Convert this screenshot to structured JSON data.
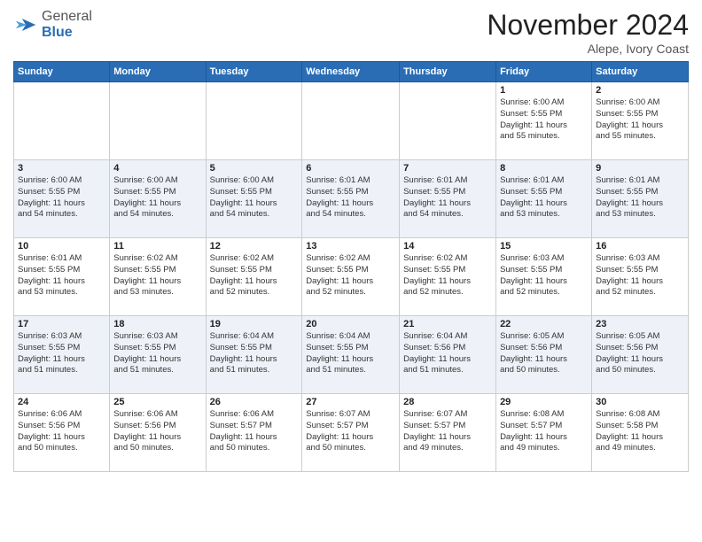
{
  "logo": {
    "general": "General",
    "blue": "Blue"
  },
  "header": {
    "month": "November 2024",
    "location": "Alepe, Ivory Coast"
  },
  "weekdays": [
    "Sunday",
    "Monday",
    "Tuesday",
    "Wednesday",
    "Thursday",
    "Friday",
    "Saturday"
  ],
  "weeks": [
    [
      {
        "day": "",
        "info": ""
      },
      {
        "day": "",
        "info": ""
      },
      {
        "day": "",
        "info": ""
      },
      {
        "day": "",
        "info": ""
      },
      {
        "day": "",
        "info": ""
      },
      {
        "day": "1",
        "info": "Sunrise: 6:00 AM\nSunset: 5:55 PM\nDaylight: 11 hours\nand 55 minutes."
      },
      {
        "day": "2",
        "info": "Sunrise: 6:00 AM\nSunset: 5:55 PM\nDaylight: 11 hours\nand 55 minutes."
      }
    ],
    [
      {
        "day": "3",
        "info": "Sunrise: 6:00 AM\nSunset: 5:55 PM\nDaylight: 11 hours\nand 54 minutes."
      },
      {
        "day": "4",
        "info": "Sunrise: 6:00 AM\nSunset: 5:55 PM\nDaylight: 11 hours\nand 54 minutes."
      },
      {
        "day": "5",
        "info": "Sunrise: 6:00 AM\nSunset: 5:55 PM\nDaylight: 11 hours\nand 54 minutes."
      },
      {
        "day": "6",
        "info": "Sunrise: 6:01 AM\nSunset: 5:55 PM\nDaylight: 11 hours\nand 54 minutes."
      },
      {
        "day": "7",
        "info": "Sunrise: 6:01 AM\nSunset: 5:55 PM\nDaylight: 11 hours\nand 54 minutes."
      },
      {
        "day": "8",
        "info": "Sunrise: 6:01 AM\nSunset: 5:55 PM\nDaylight: 11 hours\nand 53 minutes."
      },
      {
        "day": "9",
        "info": "Sunrise: 6:01 AM\nSunset: 5:55 PM\nDaylight: 11 hours\nand 53 minutes."
      }
    ],
    [
      {
        "day": "10",
        "info": "Sunrise: 6:01 AM\nSunset: 5:55 PM\nDaylight: 11 hours\nand 53 minutes."
      },
      {
        "day": "11",
        "info": "Sunrise: 6:02 AM\nSunset: 5:55 PM\nDaylight: 11 hours\nand 53 minutes."
      },
      {
        "day": "12",
        "info": "Sunrise: 6:02 AM\nSunset: 5:55 PM\nDaylight: 11 hours\nand 52 minutes."
      },
      {
        "day": "13",
        "info": "Sunrise: 6:02 AM\nSunset: 5:55 PM\nDaylight: 11 hours\nand 52 minutes."
      },
      {
        "day": "14",
        "info": "Sunrise: 6:02 AM\nSunset: 5:55 PM\nDaylight: 11 hours\nand 52 minutes."
      },
      {
        "day": "15",
        "info": "Sunrise: 6:03 AM\nSunset: 5:55 PM\nDaylight: 11 hours\nand 52 minutes."
      },
      {
        "day": "16",
        "info": "Sunrise: 6:03 AM\nSunset: 5:55 PM\nDaylight: 11 hours\nand 52 minutes."
      }
    ],
    [
      {
        "day": "17",
        "info": "Sunrise: 6:03 AM\nSunset: 5:55 PM\nDaylight: 11 hours\nand 51 minutes."
      },
      {
        "day": "18",
        "info": "Sunrise: 6:03 AM\nSunset: 5:55 PM\nDaylight: 11 hours\nand 51 minutes."
      },
      {
        "day": "19",
        "info": "Sunrise: 6:04 AM\nSunset: 5:55 PM\nDaylight: 11 hours\nand 51 minutes."
      },
      {
        "day": "20",
        "info": "Sunrise: 6:04 AM\nSunset: 5:55 PM\nDaylight: 11 hours\nand 51 minutes."
      },
      {
        "day": "21",
        "info": "Sunrise: 6:04 AM\nSunset: 5:56 PM\nDaylight: 11 hours\nand 51 minutes."
      },
      {
        "day": "22",
        "info": "Sunrise: 6:05 AM\nSunset: 5:56 PM\nDaylight: 11 hours\nand 50 minutes."
      },
      {
        "day": "23",
        "info": "Sunrise: 6:05 AM\nSunset: 5:56 PM\nDaylight: 11 hours\nand 50 minutes."
      }
    ],
    [
      {
        "day": "24",
        "info": "Sunrise: 6:06 AM\nSunset: 5:56 PM\nDaylight: 11 hours\nand 50 minutes."
      },
      {
        "day": "25",
        "info": "Sunrise: 6:06 AM\nSunset: 5:56 PM\nDaylight: 11 hours\nand 50 minutes."
      },
      {
        "day": "26",
        "info": "Sunrise: 6:06 AM\nSunset: 5:57 PM\nDaylight: 11 hours\nand 50 minutes."
      },
      {
        "day": "27",
        "info": "Sunrise: 6:07 AM\nSunset: 5:57 PM\nDaylight: 11 hours\nand 50 minutes."
      },
      {
        "day": "28",
        "info": "Sunrise: 6:07 AM\nSunset: 5:57 PM\nDaylight: 11 hours\nand 49 minutes."
      },
      {
        "day": "29",
        "info": "Sunrise: 6:08 AM\nSunset: 5:57 PM\nDaylight: 11 hours\nand 49 minutes."
      },
      {
        "day": "30",
        "info": "Sunrise: 6:08 AM\nSunset: 5:58 PM\nDaylight: 11 hours\nand 49 minutes."
      }
    ]
  ]
}
